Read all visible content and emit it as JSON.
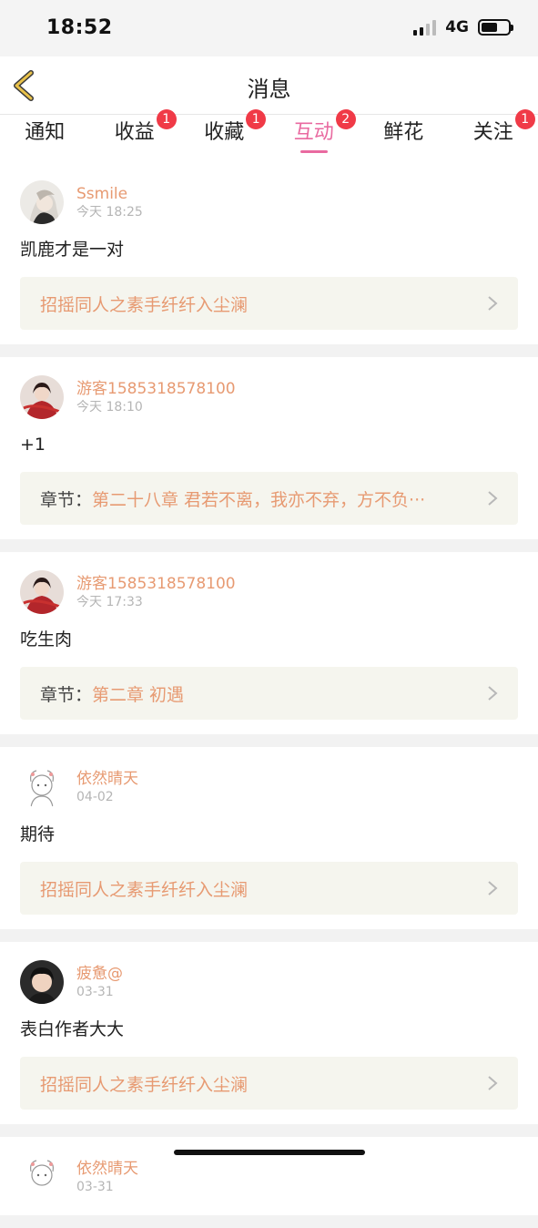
{
  "status": {
    "time": "18:52",
    "network": "4G"
  },
  "nav": {
    "title": "消息"
  },
  "tabs": [
    {
      "label": "通知",
      "badge": ""
    },
    {
      "label": "收益",
      "badge": "1"
    },
    {
      "label": "收藏",
      "badge": "1"
    },
    {
      "label": "互动",
      "badge": "2"
    },
    {
      "label": "鲜花",
      "badge": ""
    },
    {
      "label": "关注",
      "badge": "1"
    }
  ],
  "messages": [
    {
      "user": "Ssmile",
      "time": "今天 18:25",
      "content": "凯鹿才是一对",
      "ref_prefix": "",
      "ref": "招摇同人之素手纤纤入尘澜"
    },
    {
      "user": "游客1585318578100",
      "time": "今天 18:10",
      "content": "+1",
      "ref_prefix": "章节：",
      "ref": "第二十八章  君若不离，我亦不弃，方不负···"
    },
    {
      "user": "游客1585318578100",
      "time": "今天 17:33",
      "content": "吃生肉",
      "ref_prefix": "章节：",
      "ref": "第二章  初遇"
    },
    {
      "user": "依然晴天",
      "time": "04-02",
      "content": "期待",
      "ref_prefix": "",
      "ref": "招摇同人之素手纤纤入尘澜"
    },
    {
      "user": "疲惫@",
      "time": "03-31",
      "content": "表白作者大大",
      "ref_prefix": "",
      "ref": "招摇同人之素手纤纤入尘澜"
    },
    {
      "user": "依然晴天",
      "time": "03-31",
      "content": "",
      "ref_prefix": "",
      "ref": ""
    }
  ],
  "colors": {
    "accent": "#e96aa0",
    "username": "#e79a72",
    "badge": "#f03a47",
    "ref_bg": "#f5f5ee"
  }
}
